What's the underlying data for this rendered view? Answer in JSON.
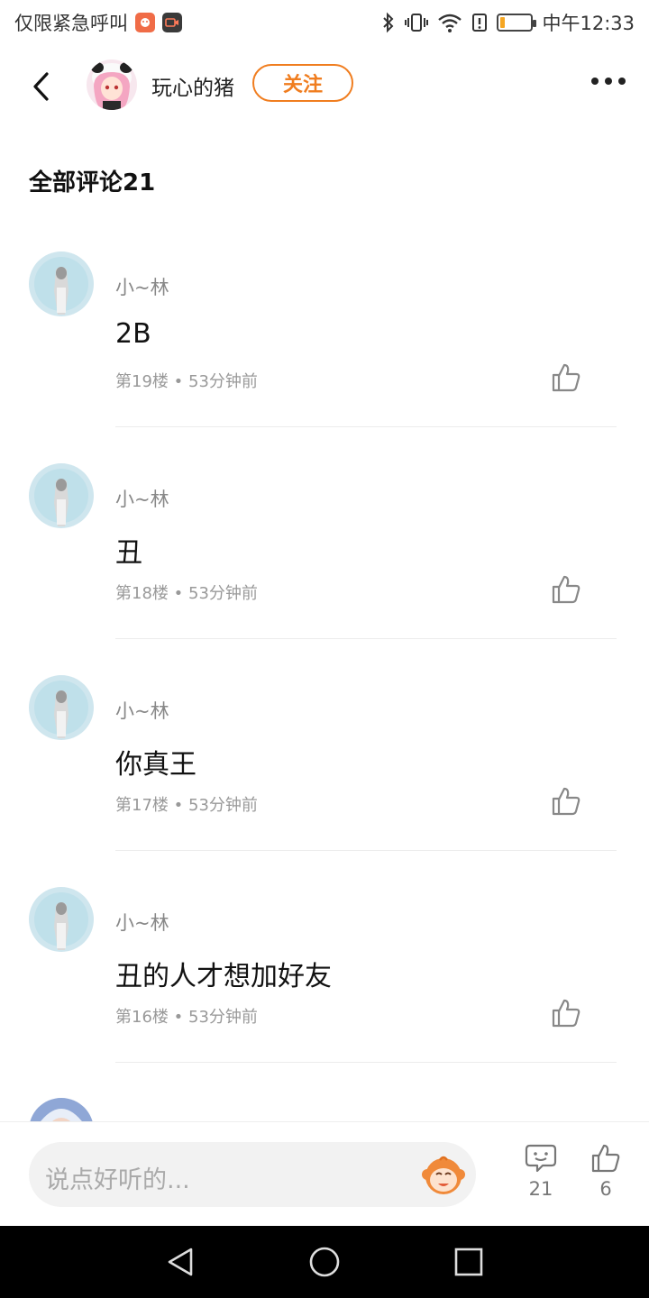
{
  "status_bar": {
    "carrier": "仅限紧急呼叫",
    "time": "中午12:33",
    "battery_level": 0.15,
    "icons": [
      "app-notification-icon",
      "screen-record-icon",
      "bluetooth-icon",
      "vibrate-icon",
      "wifi-icon",
      "alert-icon",
      "battery-icon"
    ]
  },
  "header": {
    "author_name": "玩心的猪",
    "follow_label": "关注"
  },
  "comments_title": "全部评论21",
  "comments": [
    {
      "user": "小~林",
      "text": "2B",
      "floor": "第19楼",
      "time": "53分钟前"
    },
    {
      "user": "小~林",
      "text": "丑",
      "floor": "第18楼",
      "time": "53分钟前"
    },
    {
      "user": "小~林",
      "text": "你真王",
      "floor": "第17楼",
      "time": "53分钟前"
    },
    {
      "user": "小~林",
      "text": "丑的人才想加好友",
      "floor": "第16楼",
      "time": "53分钟前"
    }
  ],
  "meta_separator": "•",
  "bottom_bar": {
    "input_placeholder": "说点好听的...",
    "comment_count": "21",
    "like_count": "6"
  },
  "colors": {
    "accent": "#f07d1f",
    "text_secondary": "#888888",
    "divider": "#ececec"
  }
}
